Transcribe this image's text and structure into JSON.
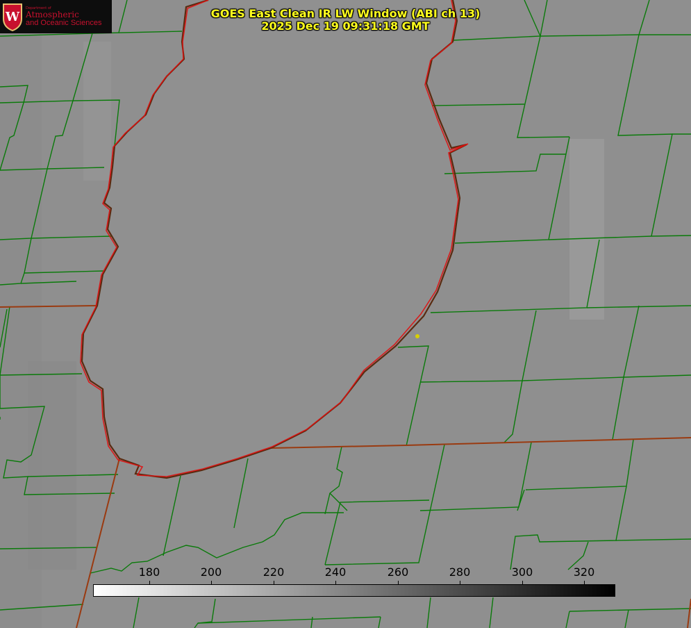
{
  "title": {
    "line1": "GOES East Clean IR LW Window (ABI ch 13)",
    "line2": "2025 Dec 19 09:31:18 GMT"
  },
  "logo": {
    "dept": "Department of",
    "line1": "Atmospheric",
    "line2": "and Oceanic Sciences",
    "seal_letter": "W"
  },
  "colorbar": {
    "ticks": [
      "180",
      "200",
      "220",
      "240",
      "260",
      "280",
      "300",
      "320"
    ],
    "min_color": "#ffffff",
    "max_color": "#000000"
  },
  "colors": {
    "county_lines": "#0a7a0a",
    "state_and_shore_lines": "#e01010",
    "title": "#ffff1e",
    "background_gray": "#8e8e8e",
    "logo_red": "#c8102e"
  }
}
